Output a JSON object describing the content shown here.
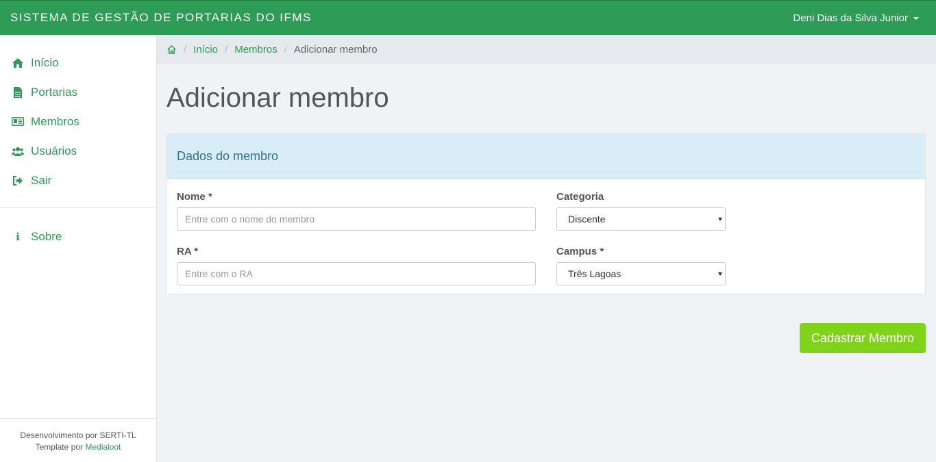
{
  "header": {
    "brand": "SISTEMA DE GESTÃO DE PORTARIAS DO IFMS",
    "user_name": "Deni Dias da Silva Junior"
  },
  "sidebar": {
    "items": [
      {
        "label": "Início",
        "icon": "home-icon"
      },
      {
        "label": "Portarias",
        "icon": "file-icon"
      },
      {
        "label": "Membros",
        "icon": "id-card-icon"
      },
      {
        "label": "Usuários",
        "icon": "users-icon"
      },
      {
        "label": "Sair",
        "icon": "sign-out-icon"
      }
    ],
    "secondary": [
      {
        "label": "Sobre",
        "icon": "info-icon"
      }
    ],
    "footer_line1": "Desenvolvimento por SERTI-TL",
    "footer_line2_prefix": "Template por",
    "footer_link": "Medialoot"
  },
  "breadcrumb": {
    "items": [
      "Início",
      "Membros"
    ],
    "current": "Adicionar membro"
  },
  "page": {
    "title": "Adicionar membro"
  },
  "form": {
    "panel_title": "Dados do membro",
    "nome_label": "Nome *",
    "nome_placeholder": "Entre com o nome do membro",
    "ra_label": "RA *",
    "ra_placeholder": "Entre com o RA",
    "categoria_label": "Categoria",
    "categoria_value": "Discente",
    "campus_label": "Campus *",
    "campus_value": "Três Lagoas",
    "submit_label": "Cadastrar Membro"
  },
  "colors": {
    "primary": "#2c9c56",
    "submit": "#7fd319",
    "panel_heading": "#d9edf7"
  }
}
